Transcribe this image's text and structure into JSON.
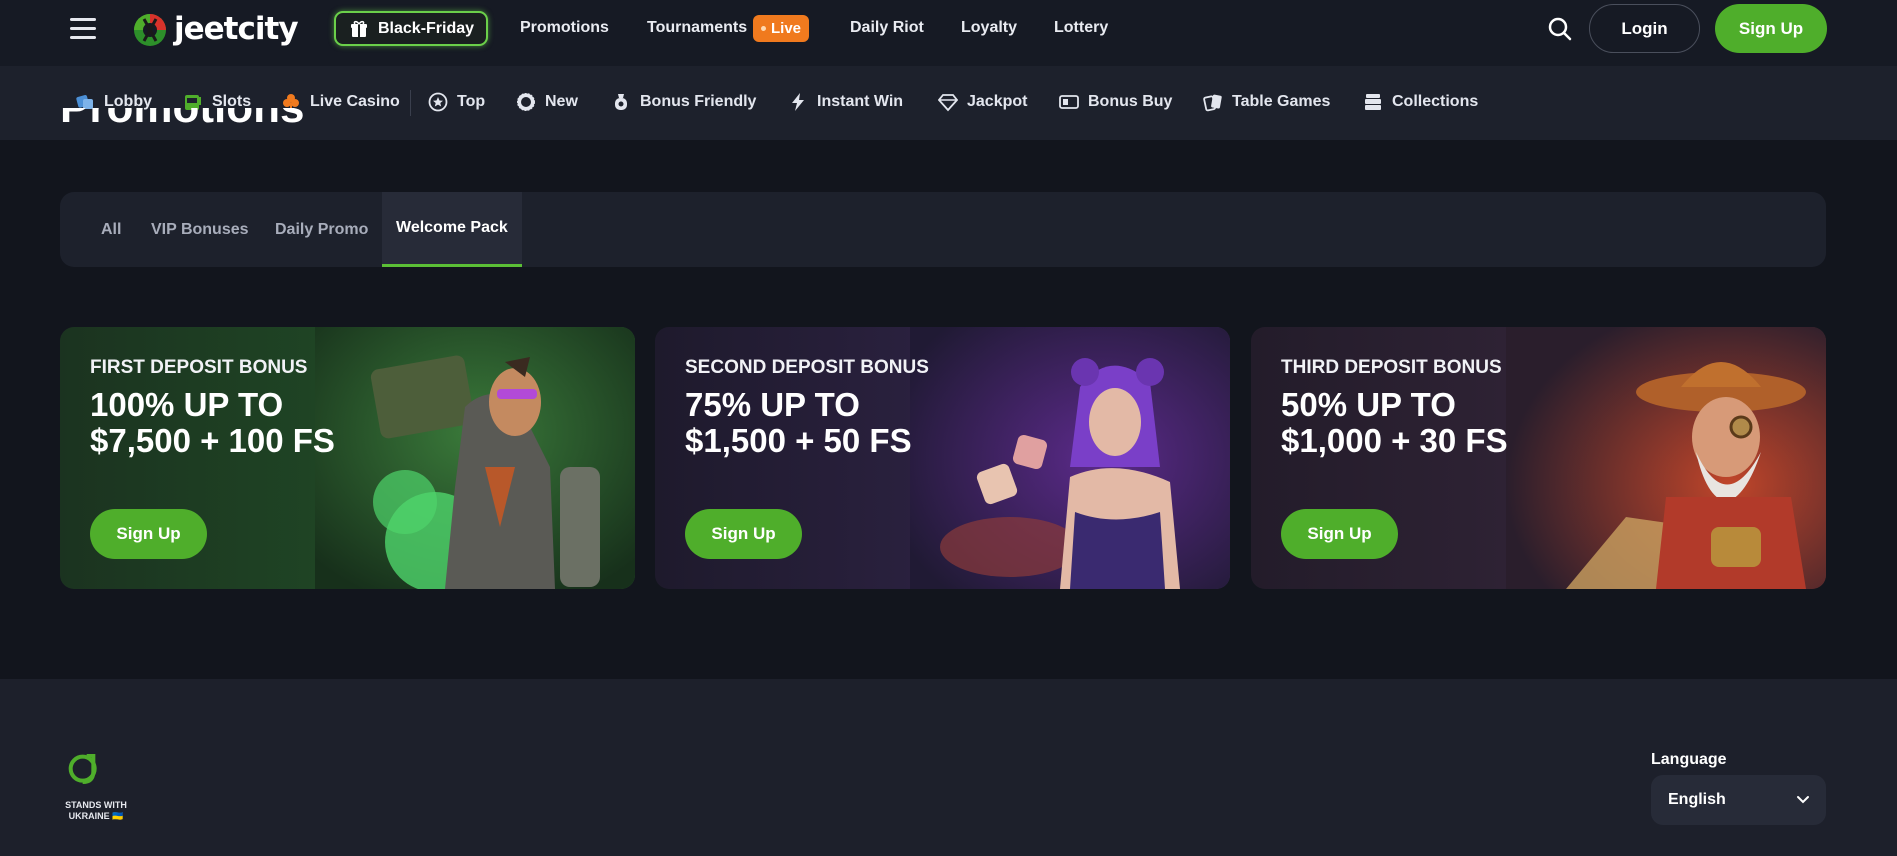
{
  "header": {
    "logo_text": "jeetcity",
    "black_friday_label": "Black-Friday",
    "nav": [
      {
        "label": "Promotions"
      },
      {
        "label": "Tournaments"
      },
      {
        "label": "Daily Riot"
      },
      {
        "label": "Loyalty"
      },
      {
        "label": "Lottery"
      }
    ],
    "live_badge": "Live",
    "login_label": "Login",
    "signup_label": "Sign Up"
  },
  "categories": [
    {
      "label": "Lobby",
      "icon": "dice-icon"
    },
    {
      "label": "Slots",
      "icon": "slot-machine-icon"
    },
    {
      "label": "Live Casino",
      "icon": "club-icon"
    },
    {
      "label": "Top",
      "icon": "star-icon"
    },
    {
      "label": "New",
      "icon": "badge-icon"
    },
    {
      "label": "Bonus Friendly",
      "icon": "coin-bag-icon"
    },
    {
      "label": "Instant Win",
      "icon": "lightning-icon"
    },
    {
      "label": "Jackpot",
      "icon": "diamond-icon"
    },
    {
      "label": "Bonus Buy",
      "icon": "ticket-icon"
    },
    {
      "label": "Table Games",
      "icon": "cards-icon"
    },
    {
      "label": "Collections",
      "icon": "stack-icon"
    }
  ],
  "page_title": "Promotions",
  "tabs": [
    {
      "label": "All",
      "active": false
    },
    {
      "label": "VIP Bonuses",
      "active": false
    },
    {
      "label": "Daily Promo",
      "active": false
    },
    {
      "label": "Welcome Pack",
      "active": true
    }
  ],
  "promos": [
    {
      "subtitle": "FIRST DEPOSIT BONUS",
      "title": "100% UP TO\n$7,500 + 100 FS",
      "button": "Sign Up"
    },
    {
      "subtitle": "SECOND DEPOSIT BONUS",
      "title": "75% UP TO\n$1,500 + 50 FS",
      "button": "Sign Up"
    },
    {
      "subtitle": "THIRD DEPOSIT BONUS",
      "title": "50% UP TO\n$1,000 + 30 FS",
      "button": "Sign Up"
    }
  ],
  "footer": {
    "ukraine_text": "STANDS WITH UKRAINE 🇺🇦",
    "language_label": "Language",
    "language_value": "English"
  },
  "colors": {
    "accent_green": "#4fae2b",
    "live_orange": "#f07a1e",
    "background": "#12151d"
  }
}
